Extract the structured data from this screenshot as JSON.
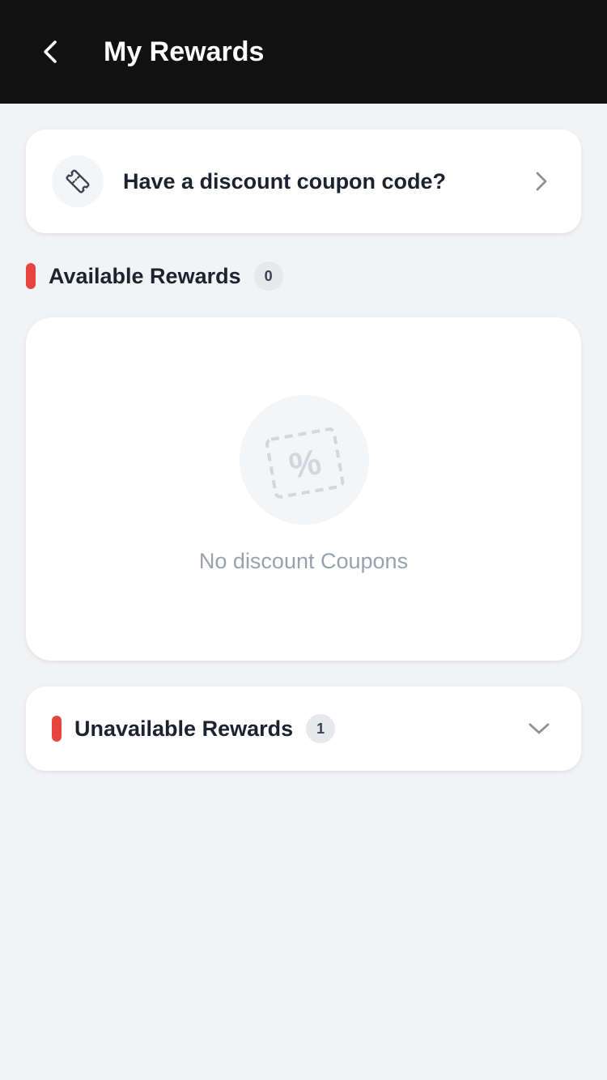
{
  "header": {
    "title": "My Rewards",
    "back_icon": "chevron-left-icon",
    "background_color": "#111111"
  },
  "coupon_entry": {
    "label": "Have a discount coupon code?",
    "icon": "ticket-icon",
    "action_icon": "chevron-right-icon"
  },
  "available_rewards": {
    "title": "Available Rewards",
    "count": "0",
    "accent_color": "#e5443f",
    "empty_state": {
      "icon": "percent-coupon-icon",
      "message": "No discount Coupons"
    }
  },
  "unavailable_rewards": {
    "title": "Unavailable Rewards",
    "count": "1",
    "accent_color": "#e5443f",
    "toggle_icon": "chevron-down-icon"
  }
}
